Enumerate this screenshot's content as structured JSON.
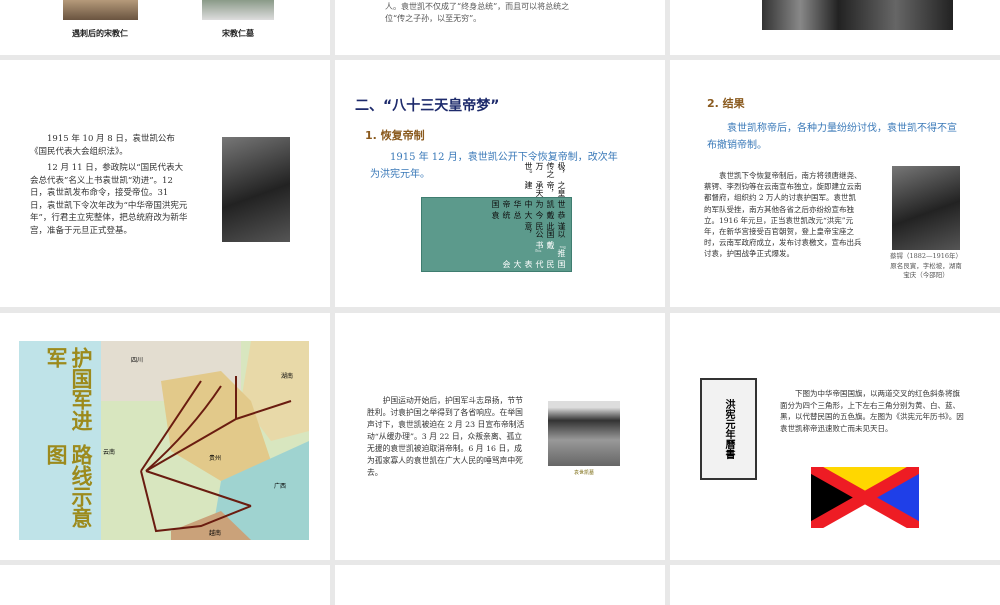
{
  "slides": [
    {
      "captions": [
        "遇刺后的宋教仁",
        "宋教仁墓"
      ]
    },
    {
      "text": [
        "人。袁世凯不仅成了“终身总统”，而且可以将总统之",
        "位“传之子孙，以至无穷”。"
      ]
    },
    {},
    {
      "paragraphs": [
        "1915 年 10 月 8 日，袁世凯公布《国民代表大会组织法》。",
        "12 月 11 日，参政院以“国民代表大会总代表”名义上书袁世凯“劝进”。12 日，袁世凯发布命令，接受帝位。31 日，袁世凯下令次年改为“中华帝国洪宪元年”，行君主立宪整体，把总统府改为新华宫，准备于元旦正式登基。"
      ]
    },
    {
      "title": "二、“八十三天皇帝梦”",
      "subtitle": "1. 恢复帝制",
      "body": "1915 年 12 月，袁世凯公开下令恢复帝制，改次年为洪宪元年。",
      "scroll_title": "国民代表大会",
      "scroll_name": "『推戴书』",
      "scroll_cols": [
        "谨以此国民公意，",
        "恭戴今大总统袁",
        "世凯为中华帝国",
        "之皇帝，承天建",
        "极，传之万世。"
      ]
    },
    {
      "subtitle": "2. 结果",
      "body": "袁世凯称帝后，各种力量纷纷讨伐，袁世凯不得不宣布撤销帝制。",
      "detail": "袁世凯下令恢复帝制后，南方将领唐继尧、蔡锷、李烈钧等在云南宣布独立，旋即建立云南都督府，组织约 2 万人的讨袁护国军。袁世凯的军队受挫，南方其他各省之后亦纷纷宣布独立。1916 年元旦，正当袁世凯改元“洪宪”元年，在新华宫接受百官朝贺，登上皇帝宝座之时，云南军政府成立，发布讨袁檄文，宣布出兵讨袁，护国战争正式爆发。",
      "caption": "蔡锷（1882—1916年）原名艮寅，字松坡，湖南宝庆（今邵阳）"
    },
    {
      "map_title_col1": "护国军进军",
      "map_title_col2": "路线示意图",
      "map_labels": [
        "四川",
        "云南",
        "贵州",
        "广西",
        "湖南",
        "越南"
      ]
    },
    {
      "body": "护国运动开始后，护国军斗志昂扬，节节胜利。讨袁护国之举得到了各省响应。在举国声讨下，袁世凯被迫在 2 月 23 日宣布帝制活动“从缓办理”。3 月 22 日，众叛亲离、孤立无援的袁世凯被迫取消帝制。6 月 16 日，成为孤家寡人的袁世凯在广大人民的唾骂声中死去。",
      "caption": "袁世凯墓"
    },
    {
      "book_text": "洪宪元年曆書",
      "body": "下图为中华帝国国旗，以两道交叉的红色斜条将旗面分为四个三角形，上下左右三角分别为黄、白、蓝、黑，以代替民国的五色旗。左图为《洪宪元年历书》。因袁世凯称帝迅速败亡而未见天日。",
      "flag_colors": {
        "cross": "#ee1c24",
        "top": "#ffd700",
        "bottom": "#ffffff",
        "left": "#000000",
        "right": "#1f3fe8"
      }
    }
  ]
}
